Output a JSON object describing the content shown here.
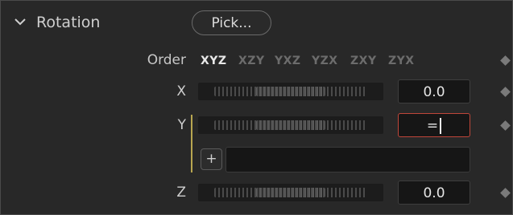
{
  "header": {
    "title": "Rotation",
    "pick_label": "Pick..."
  },
  "order": {
    "label": "Order",
    "options": [
      "XYZ",
      "XZY",
      "YXZ",
      "YZX",
      "ZXY",
      "ZYX"
    ],
    "selected": "XYZ"
  },
  "axes": {
    "x": {
      "label": "X",
      "value": "0.0"
    },
    "y": {
      "label": "Y",
      "value": "="
    },
    "z": {
      "label": "Z",
      "value": "0.0"
    }
  },
  "expression": {
    "add_label": "+"
  },
  "icons": {
    "collapse": "chevron-down-icon",
    "keyframe": "diamond-icon"
  },
  "colors": {
    "editing_border": "#c0463a",
    "expression_link": "#b8a650"
  }
}
